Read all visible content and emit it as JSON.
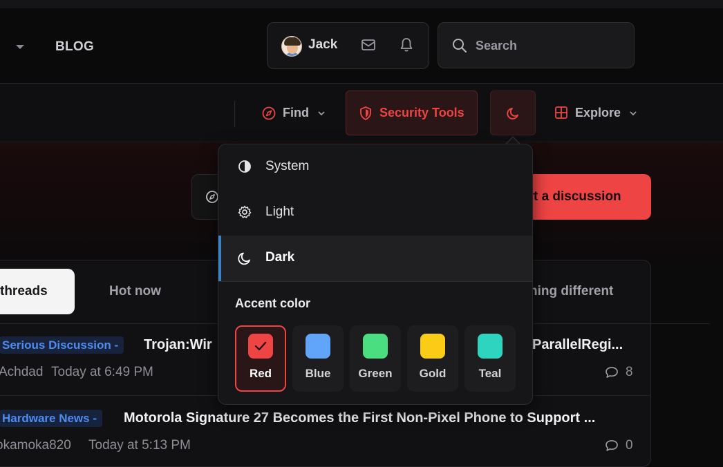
{
  "header": {
    "blog_label": "BLOG",
    "user": {
      "name": "Jack"
    },
    "search": {
      "placeholder": "Search"
    }
  },
  "nav": {
    "find_label": "Find",
    "security_label": "Security Tools",
    "explore_label": "Explore",
    "accent_color": "#ef4444"
  },
  "hero": {
    "start_discussion_label": "art a discussion"
  },
  "tabs": {
    "active_label": "threads",
    "hot_label": "Hot now",
    "different_label": "hing different"
  },
  "threads": [
    {
      "tag": "Serious Discussion -",
      "title_left": "Trojan:Wir",
      "title_right": "ParallelRegi...",
      "author": "Achdad",
      "time": "Today at 6:49 PM",
      "replies": "8"
    },
    {
      "tag": "Hardware News -",
      "title": "Motorola Signature 27 Becomes the First Non-Pixel Phone to Support ...",
      "author": "okamoka820",
      "time": "Today at 5:13 PM",
      "replies": "0"
    }
  ],
  "theme_menu": {
    "items": [
      {
        "label": "System",
        "icon": "half-circle-icon"
      },
      {
        "label": "Light",
        "icon": "gear-icon"
      },
      {
        "label": "Dark",
        "icon": "moon-icon",
        "active": true
      }
    ],
    "accent_title": "Accent color",
    "accents": [
      {
        "label": "Red",
        "color": "#ef4444",
        "selected": true
      },
      {
        "label": "Blue",
        "color": "#60a5fa"
      },
      {
        "label": "Green",
        "color": "#4ade80"
      },
      {
        "label": "Gold",
        "color": "#facc15"
      },
      {
        "label": "Teal",
        "color": "#2dd4bf"
      }
    ]
  }
}
